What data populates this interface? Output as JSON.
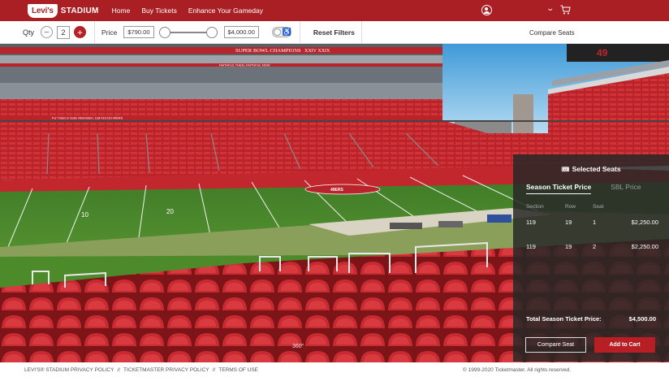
{
  "nav": {
    "logo_badge": "Levi's",
    "logo_text": "STADIUM",
    "links": [
      "Home",
      "Buy Tickets",
      "Enhance Your Gameday"
    ]
  },
  "filters": {
    "qty_label": "Qty",
    "qty_value": "2",
    "minus": "−",
    "plus": "+",
    "price_label": "Price",
    "price_min": "$790.00",
    "price_max": "$4,000.00",
    "reset": "Reset Filters",
    "compare": "Compare Seats"
  },
  "stadium": {
    "banner": "SUPER BOWL CHAMPIONS",
    "banner_years": "XXIV XXIX",
    "faithful": "FAITHFUL THEN, FAITHFUL NOW",
    "info_text": "For Ticket or Suite information, Call 415-GO-49ERS",
    "logo_text": "49ERS",
    "yard_10": "10",
    "yard_20": "20",
    "view_badge": "360°"
  },
  "panel": {
    "title": "Selected Seats",
    "tab_active": "Season Ticket Price",
    "tab_inactive": "SBL Price",
    "col_headers": [
      "Section",
      "Row",
      "Seat",
      ""
    ],
    "rows": [
      {
        "section": "119",
        "row": "19",
        "seat": "1",
        "price": "$2,250.00"
      },
      {
        "section": "119",
        "row": "19",
        "seat": "2",
        "price": "$2,250.00"
      }
    ],
    "total_label": "Total Season Ticket Price:",
    "total_value": "$4,500.00",
    "compare_btn": "Compare Seat",
    "cart_btn": "Add to Cart"
  },
  "footer": {
    "links": [
      "LEVI'S® STADIUM PRIVACY POLICY",
      "//",
      "TICKETMASTER PRIVACY POLICY",
      "//",
      "TERMS OF USE"
    ],
    "copyright": "© 1999-2020 Ticketmaster. All rights reserved."
  },
  "colors": {
    "brand_red": "#aa1f24",
    "field_green": "#4f8a2e",
    "seat_red": "#c0262b"
  }
}
